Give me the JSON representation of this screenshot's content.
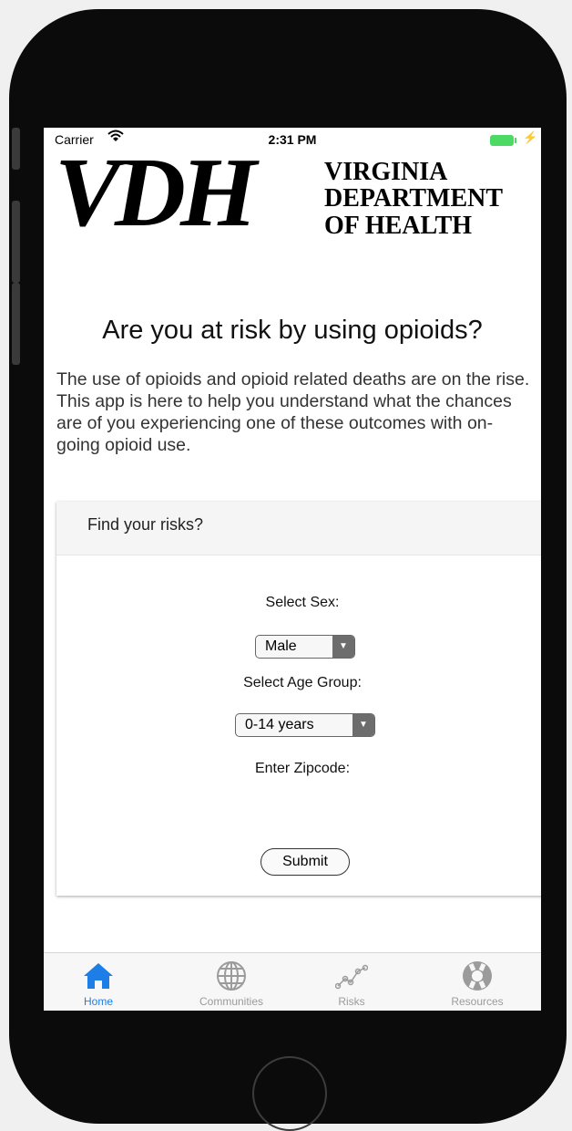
{
  "status_bar": {
    "carrier": "Carrier",
    "wifi_icon": "wifi-icon",
    "time": "2:31 PM",
    "battery_icon": "battery-icon",
    "charging_icon": "charging-bolt-icon",
    "charging_glyph": "⚡"
  },
  "logo": {
    "letters": "VDH",
    "line1": "VIRGINIA",
    "line2": "DEPARTMENT",
    "line3": "OF HEALTH"
  },
  "headline": "Are you at risk by using opioids?",
  "intro": "The use of opioids and opioid related deaths are on the rise. This app is here to help you understand what the chances are of you experiencing one of these outcomes with on-going opioid use.",
  "form": {
    "title": "Find your risks?",
    "sex_label": "Select Sex:",
    "sex_value": "Male",
    "age_label": "Select Age Group:",
    "age_value": "0-14 years",
    "zip_label": "Enter Zipcode:",
    "submit_label": "Submit",
    "dropdown_arrow": "▼"
  },
  "tabs": [
    {
      "label": "Home",
      "icon": "home-icon",
      "active": true
    },
    {
      "label": "Communities",
      "icon": "globe-icon",
      "active": false
    },
    {
      "label": "Risks",
      "icon": "line-chart-icon",
      "active": false
    },
    {
      "label": "Resources",
      "icon": "life-ring-icon",
      "active": false
    }
  ],
  "colors": {
    "active_tab": "#1e7ee8",
    "inactive_tab": "#9b9b9b",
    "battery": "#4cd964"
  }
}
